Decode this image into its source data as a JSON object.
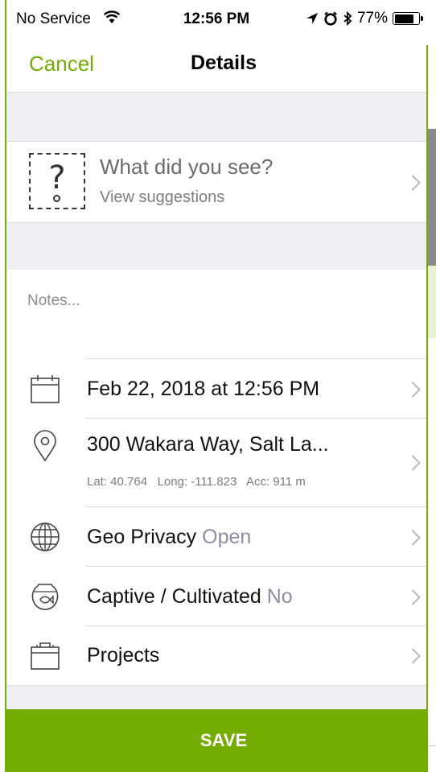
{
  "status_bar": {
    "carrier": "No Service",
    "time": "12:56 PM",
    "battery": "77%",
    "icons": [
      "wifi-icon",
      "location-arrow-icon",
      "alarm-icon",
      "bluetooth-icon",
      "battery-icon"
    ]
  },
  "nav": {
    "cancel_label": "Cancel",
    "title": "Details"
  },
  "taxon": {
    "prompt": "What did you see?",
    "suggestions_label": "View suggestions",
    "icon": "unknown-species-icon"
  },
  "notes": {
    "placeholder": "Notes..."
  },
  "rows": {
    "date": {
      "label": "Feb 22, 2018 at 12:56 PM",
      "icon": "calendar-icon"
    },
    "location": {
      "label": "300 Wakara Way, Salt La...",
      "lat": "Lat: 40.764",
      "long": "Long: -111.823",
      "acc": "Acc: 911 m",
      "icon": "map-pin-icon"
    },
    "geo_privacy": {
      "label": "Geo Privacy",
      "value": "Open",
      "icon": "globe-icon"
    },
    "captive": {
      "label": "Captive / Cultivated",
      "value": "No",
      "icon": "fishbowl-icon"
    },
    "projects": {
      "label": "Projects",
      "icon": "briefcase-icon"
    }
  },
  "save": {
    "label": "SAVE"
  },
  "colors": {
    "accent": "#74ac00",
    "group_background": "#efeff4",
    "secondary_text": "#8e8ea0"
  }
}
